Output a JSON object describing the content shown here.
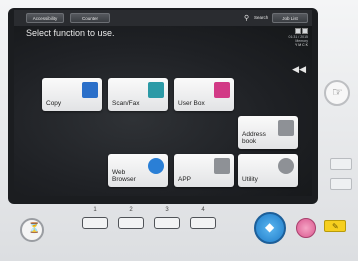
{
  "topbar": {
    "accessibility_label": "Accessibility",
    "counter_label": "Counter",
    "search_label": "Search",
    "job_list_label": "Job List"
  },
  "screen": {
    "title": "Select function to use.",
    "status_time": "01:31 / 2015",
    "status_memory": "Memory",
    "status_toner": "Y M C K"
  },
  "tiles": [
    {
      "label": "Copy",
      "icon": "copy-icon",
      "color": "#2a6fc9"
    },
    {
      "label": "Scan/Fax",
      "icon": "scan-fax-icon",
      "color": "#2c9aa6"
    },
    {
      "label": "User Box",
      "icon": "user-box-icon",
      "color": "#d23a86"
    },
    {
      "label": "Address book",
      "icon": "address-book-icon",
      "color": "#8e9196"
    },
    {
      "label": "Web Browser",
      "icon": "web-browser-icon",
      "color": "#2a7fd6"
    },
    {
      "label": "APP",
      "icon": "app-icon",
      "color": "#8e9196"
    },
    {
      "label": "Utility",
      "icon": "utility-icon",
      "color": "#8e9196"
    }
  ],
  "keypad": {
    "keys": [
      "1",
      "2",
      "3",
      "4"
    ]
  },
  "colors": {
    "start": "#2b8fd8",
    "stop": "#e06fa0",
    "access": "#f2c200"
  }
}
